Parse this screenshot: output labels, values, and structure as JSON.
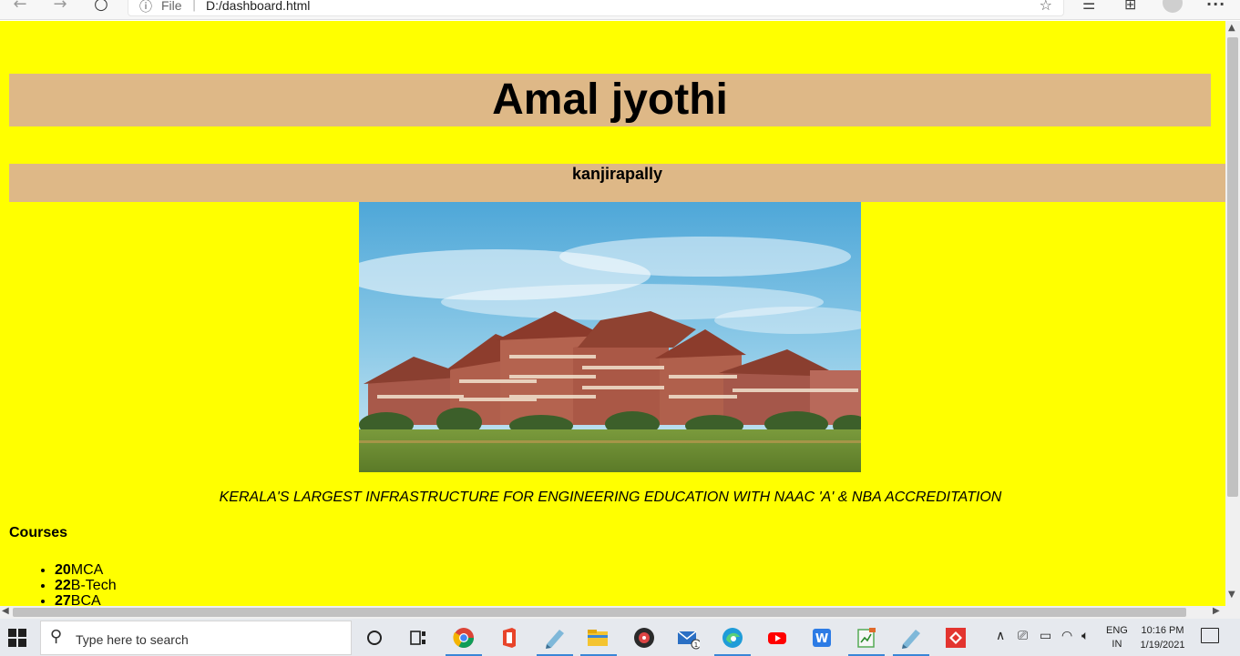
{
  "browser": {
    "file_label": "File",
    "url": "D:/dashboard.html"
  },
  "page": {
    "title": "Amal jyothi",
    "subtitle": "kanjirapally",
    "tagline": "KERALA'S LARGEST INFRASTRUCTURE FOR ENGINEERING EDUCATION WITH NAAC 'A' & NBA ACCREDITATION",
    "courses_heading": "Courses",
    "courses": [
      {
        "count": "20",
        "name": "MCA"
      },
      {
        "count": "22",
        "name": "B-Tech"
      },
      {
        "count": "27",
        "name": "BCA"
      }
    ]
  },
  "taskbar": {
    "search_placeholder": "Type here to search",
    "lang_line1": "ENG",
    "lang_line2": "IN",
    "time": "10:16 PM",
    "date": "1/19/2021",
    "mail_badge": "1"
  },
  "colors": {
    "page_bg": "#ffff00",
    "banner_bg": "#deb887"
  }
}
